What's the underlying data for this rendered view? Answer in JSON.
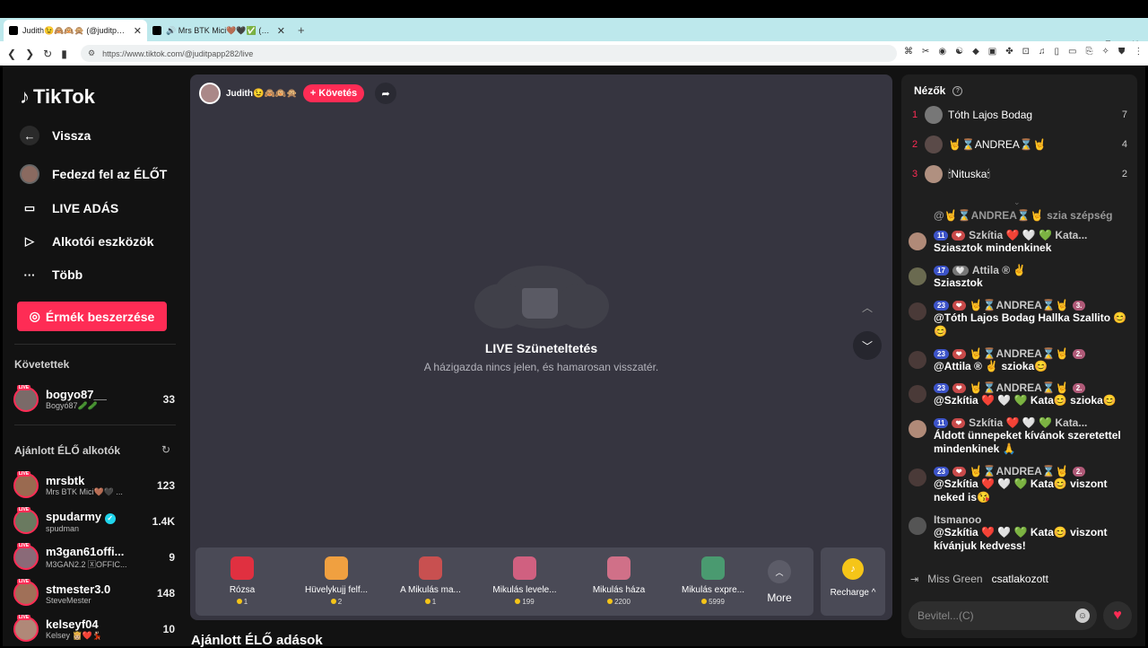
{
  "browser": {
    "tabs": [
      {
        "title": "Judith😉🙈🙉🙊 (@juditpapp...",
        "active": true
      },
      {
        "title": "🔊 Mrs BTK Mici🤎🖤✅ (@mrsb...",
        "active": false
      }
    ],
    "new_tab": "+",
    "url": "https://www.tiktok.com/@juditpapp282/live",
    "window_controls": [
      "–",
      "⧉",
      "✕"
    ]
  },
  "sidebar": {
    "logo": "TikTok",
    "back": "Vissza",
    "nav": [
      "Fedezd fel az ÉLŐT",
      "LIVE ADÁS",
      "Alkotói eszközök",
      "Több"
    ],
    "coins_button": "Érmék beszerzése",
    "following_title": "Követettek",
    "following": [
      {
        "name": "bogyo87__",
        "sub": "Bogyó87🥒🥒",
        "count": "33"
      }
    ],
    "suggested_title": "Ajánlott ÉLŐ alkotók",
    "suggested": [
      {
        "name": "mrsbtk",
        "sub": "Mrs BTK Mici🤎🖤 ...",
        "count": "123"
      },
      {
        "name": "spudarmy",
        "sub": "spudman",
        "count": "1.4K",
        "verified": true
      },
      {
        "name": "m3gan61offi...",
        "sub": "M3GAN2.2 🅇OFFIC...",
        "count": "9"
      },
      {
        "name": "stmester3.0",
        "sub": "SteveMester",
        "count": "148"
      },
      {
        "name": "kelseyf04",
        "sub": "Kelsey 👸🏼❤️💃🏻",
        "count": "10"
      }
    ],
    "live_tag": "LIVE"
  },
  "stream": {
    "host_name": "Judith😉🙈🙉🙊",
    "follow_label": "+ Követés",
    "paused_title": "LIVE Szüneteltetés",
    "paused_sub": "A házigazda nincs jelen, és hamarosan visszatér.",
    "gifts": [
      {
        "name": "Rózsa",
        "price": "1",
        "color": "#e03040"
      },
      {
        "name": "Hüvelykujj felf...",
        "price": "2",
        "color": "#f0a040"
      },
      {
        "name": "A Mikulás ma...",
        "price": "1",
        "color": "#c85050"
      },
      {
        "name": "Mikulás levele...",
        "price": "199",
        "color": "#d06080"
      },
      {
        "name": "Mikulás háza",
        "price": "2200",
        "color": "#d07088"
      },
      {
        "name": "Mikulás expre...",
        "price": "5999",
        "color": "#4a9a70"
      }
    ],
    "more_label": "More",
    "recharge_label": "Recharge ^",
    "suggested_section": "Ajánlott ÉLŐ adások"
  },
  "viewers": {
    "title": "Nézők",
    "list": [
      {
        "rank": "1",
        "name": "Tóth Lajos Bodag",
        "count": "7"
      },
      {
        "rank": "2",
        "name": "🤘⌛ANDREA⌛🤘",
        "count": "4"
      },
      {
        "rank": "3",
        "name": "🕯Nituska🕯",
        "count": "2"
      }
    ]
  },
  "chat": {
    "messages": [
      {
        "name": "",
        "badges": [],
        "text": "@🤘⌛ANDREA⌛🤘 szia szépség"
      },
      {
        "name": "Szkítia ❤️ 🤍 💚 Kata...",
        "badges": [
          "11",
          "❤"
        ],
        "text": "Sziasztok mindenkinek"
      },
      {
        "name": "Attila ® ✌️",
        "badges": [
          "17",
          "🤍"
        ],
        "text": "Sziasztok"
      },
      {
        "name": "🤘⌛ANDREA⌛🤘",
        "badges": [
          "23",
          "❤",
          "3."
        ],
        "text": "@Tóth Lajos Bodag Hallka Szallito 😊😊"
      },
      {
        "name": "🤘⌛ANDREA⌛🤘",
        "badges": [
          "23",
          "❤",
          "2."
        ],
        "text": "@Attila ® ✌️ szioka😊"
      },
      {
        "name": "🤘⌛ANDREA⌛🤘",
        "badges": [
          "23",
          "❤",
          "2."
        ],
        "text": "@Szkítia ❤️ 🤍 💚 Kata😊 szioka😊"
      },
      {
        "name": "Szkítia ❤️ 🤍 💚 Kata...",
        "badges": [
          "11",
          "❤"
        ],
        "text": "Áldott ünnepeket kívánok szeretettel mindenkinek 🙏"
      },
      {
        "name": "🤘⌛ANDREA⌛🤘",
        "badges": [
          "23",
          "❤",
          "2."
        ],
        "text": "@Szkítia ❤️ 🤍 💚 Kata😊 viszont neked is😘"
      },
      {
        "name": "Itsmanoo",
        "badges": [],
        "text": "@Szkítia ❤️ 🤍 💚 Kata😊 viszont kívánjuk kedvess!"
      }
    ],
    "join_name": "Miss Green",
    "join_text": "csatlakozott",
    "input_placeholder": "Bevitel...(C)"
  }
}
